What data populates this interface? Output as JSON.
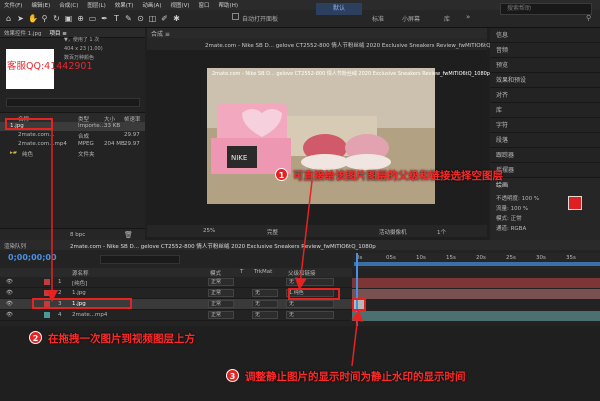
{
  "menu": [
    "文件(F)",
    "编辑(E)",
    "合成(C)",
    "图层(L)",
    "效果(T)",
    "动画(A)",
    "视图(V)",
    "窗口",
    "帮助(H)"
  ],
  "toolbar": {
    "auto_open": "自动打开面板",
    "workspaces": [
      "默认",
      "标准",
      "小屏幕",
      "库"
    ],
    "search_placeholder": "搜索帮助"
  },
  "project": {
    "tabs": [
      "效果控件 1.jpg",
      "项目 ≡"
    ],
    "thumb_watermark": "客服QQ:41442901",
    "info_lines": [
      "▼，使用了 1 次",
      "404 x 23 (1.00)",
      "数百万种颜色"
    ],
    "columns": [
      "名称",
      "类型",
      "大小",
      "帧速率"
    ],
    "rows": [
      {
        "name": "1.jpg",
        "type": "Importe…",
        "size": "33 KB",
        "fps": ""
      },
      {
        "name": "2mate.com...",
        "type": "合成",
        "size": "",
        "fps": "29.97"
      },
      {
        "name": "2mate.com...mp4",
        "type": "MPEG",
        "size": "204 MB",
        "fps": "29.97"
      },
      {
        "name": "纯色",
        "type": "文件夹",
        "size": "",
        "fps": ""
      }
    ],
    "footer": "8 bpc"
  },
  "comp": {
    "title": "2mate.com - Nike SB D... gelove CT2552-800 情人节粉丝绒 2020 Exclusive Sneakers Review_fwMiTIO6tQ_1080p",
    "zoom": "25%",
    "res": "完整",
    "camera": "活动摄像机",
    "views": "1个"
  },
  "right_panels": [
    "信息",
    "音频",
    "预览",
    "效果和预设",
    "对齐",
    "库",
    "字符",
    "段落",
    "跟踪器",
    "摇摆器"
  ],
  "brush": {
    "label": "绘画",
    "opacity_label": "不透明度: 100 %",
    "flow_label": "流量: 100 %",
    "mode_label": "模式: 正常",
    "channel_label": "通道: RGBA",
    "color": "#e02020"
  },
  "timeline": {
    "tab_render": "渲染队列",
    "tab_comp": "2mate.com - Nike SB D... gelove CT2552-800 情人节粉丝绒 2020 Exclusive Sneakers Review_fwMiTIO6tQ_1080p",
    "timecode": "0;00;00;00",
    "headers": [
      "源名称",
      "模式",
      "T",
      "TrkMat",
      "父级和链接"
    ],
    "ruler_labels": [
      "0s",
      "05s",
      "10s",
      "15s",
      "20s",
      "25s",
      "30s",
      "35s"
    ],
    "layers": [
      {
        "num": "1",
        "name": "[纯色]",
        "mode": "正常",
        "trk": "",
        "parent": "无",
        "color": "#c43b3b"
      },
      {
        "num": "2",
        "name": "1.jpg",
        "mode": "正常",
        "trk": "无",
        "parent": "1.纯色",
        "color": "#c43b3b"
      },
      {
        "num": "3",
        "name": "1.jpg",
        "mode": "正常",
        "trk": "无",
        "parent": "无",
        "color": "#c43b3b"
      },
      {
        "num": "4",
        "name": "2mate...mp4",
        "mode": "正常",
        "trk": "无",
        "parent": "无",
        "color": "#4a9a9a"
      }
    ]
  },
  "annotations": {
    "a1": "可直接给该图片图层的父级和链接选择空图层",
    "a2": "在拖拽一次图片到视频图层上方",
    "a3": "调整静止图片的显示时间为静止水印的显示时间",
    "n1": "1",
    "n2": "2",
    "n3": "3"
  }
}
